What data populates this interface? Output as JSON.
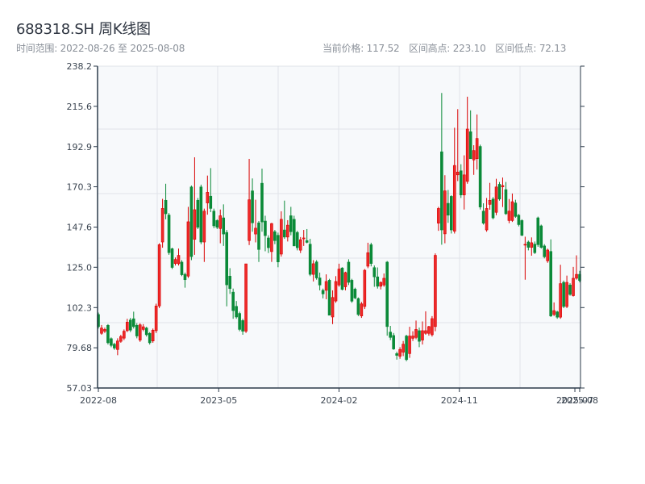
{
  "header": {
    "title": "688318.SH 周K线图",
    "range_label": "时间范围: 2022-08-26 至 2025-08-08",
    "stats": [
      "当前价格: 117.52",
      "区间高点: 223.10",
      "区间低点: 72.13"
    ]
  },
  "colors": {
    "up": "#d90000",
    "down": "#0b8a38",
    "axis": "#2b3a4a",
    "grid": "#e1e4e9",
    "plot_bg": "#f7f9fb"
  },
  "chart_data": {
    "type": "candlestick",
    "title": "688318.SH 周K线图",
    "ylim": [
      57.03,
      238.2
    ],
    "yticks": [
      "57.03",
      "79.68",
      "102.3",
      "125.0",
      "147.6",
      "170.3",
      "192.9",
      "215.6",
      "238.2"
    ],
    "xticks": [
      {
        "label": "2022-08",
        "at": 0
      },
      {
        "label": "2023-05",
        "at": 37.5
      },
      {
        "label": "2024-02",
        "at": 75
      },
      {
        "label": "2024-11",
        "at": 112.5
      },
      {
        "label": "2025-07",
        "at": 148.5
      },
      {
        "label": "2025-08",
        "at": 150
      }
    ],
    "grid": true,
    "ohlc_fields": [
      "open",
      "high",
      "low",
      "close"
    ],
    "candles": [
      [
        98.4,
        99.5,
        90.5,
        91.6
      ],
      [
        87.8,
        92.5,
        87,
        90.8
      ],
      [
        89,
        91,
        88,
        90
      ],
      [
        92.3,
        93,
        81.5,
        82.5
      ],
      [
        84.8,
        85.5,
        80,
        81
      ],
      [
        81.7,
        82.5,
        78.5,
        79.5
      ],
      [
        78.7,
        85,
        75.5,
        83.5
      ],
      [
        83.3,
        87,
        82.5,
        86
      ],
      [
        85.1,
        90,
        84,
        89
      ],
      [
        89.3,
        96,
        88.5,
        94.1
      ],
      [
        95.3,
        96.5,
        88.5,
        89.6
      ],
      [
        96,
        100,
        90.5,
        91.6
      ],
      [
        92.3,
        93.5,
        85,
        86.3
      ],
      [
        84,
        93.5,
        83,
        92.6
      ],
      [
        90,
        93,
        89,
        91.5
      ],
      [
        90.8,
        91.5,
        86,
        87
      ],
      [
        87.8,
        88.5,
        81.5,
        82.5
      ],
      [
        83.5,
        90.5,
        82.5,
        89.6
      ],
      [
        89.3,
        104.5,
        88,
        103.2
      ],
      [
        103.2,
        138.5,
        102,
        137.7
      ],
      [
        139.2,
        163.5,
        136,
        158.1
      ],
      [
        162.7,
        172,
        152,
        155.1
      ],
      [
        154.4,
        155.5,
        132,
        133.2
      ],
      [
        135.4,
        136,
        124,
        124.9
      ],
      [
        127.1,
        130.5,
        126,
        129.4
      ],
      [
        127,
        135.5,
        126,
        131.7
      ],
      [
        127.9,
        129,
        120,
        120.8
      ],
      [
        121,
        122,
        113.5,
        118
      ],
      [
        120,
        159,
        119,
        150.6
      ],
      [
        170.2,
        171,
        129,
        131
      ],
      [
        140.7,
        186.9,
        132,
        157.4
      ],
      [
        162.7,
        164,
        146.5,
        147.5
      ],
      [
        170.2,
        171.5,
        138,
        139.2
      ],
      [
        139.2,
        158,
        128,
        156.6
      ],
      [
        161.2,
        176.6,
        154.6,
        167.2
      ],
      [
        165,
        180.8,
        156,
        158.1
      ],
      [
        156.6,
        158,
        147,
        148.3
      ],
      [
        151.3,
        152,
        146.5,
        147.5
      ],
      [
        146.8,
        157.5,
        138.5,
        154
      ],
      [
        152.8,
        160.4,
        137,
        143.7
      ],
      [
        144.6,
        146,
        103,
        115.1
      ],
      [
        120,
        124.5,
        110,
        113
      ],
      [
        111,
        113,
        96,
        100.6
      ],
      [
        103,
        106,
        96,
        97
      ],
      [
        99,
        100,
        89,
        90
      ],
      [
        95,
        96,
        87,
        89
      ],
      [
        89,
        127,
        88,
        126.9
      ],
      [
        140,
        186,
        137.5,
        163
      ],
      [
        168,
        175,
        145,
        150
      ],
      [
        143.7,
        163,
        139,
        147
      ],
      [
        150,
        151,
        128,
        135
      ],
      [
        172.3,
        180.5,
        145,
        150.5
      ],
      [
        151,
        154,
        134,
        142.8
      ],
      [
        141.5,
        143,
        133,
        136
      ],
      [
        133.8,
        150,
        128,
        149.6
      ],
      [
        145,
        146,
        138,
        140
      ],
      [
        143,
        144.5,
        125,
        128
      ],
      [
        132.4,
        156.5,
        131,
        152
      ],
      [
        146,
        162.5,
        141,
        142
      ],
      [
        142,
        151.5,
        139.5,
        148.7
      ],
      [
        154,
        159,
        143,
        145
      ],
      [
        152,
        154,
        137,
        137
      ],
      [
        144.6,
        145.5,
        134.5,
        136
      ],
      [
        134.6,
        142,
        133,
        140.5
      ],
      [
        141,
        146,
        137,
        141.5
      ],
      [
        140,
        146.5,
        138.5,
        139
      ],
      [
        138,
        141,
        120,
        121
      ],
      [
        121,
        129,
        117,
        127
      ],
      [
        128,
        129,
        118,
        119
      ],
      [
        119,
        122,
        112,
        115
      ],
      [
        112,
        113,
        107.5,
        110
      ],
      [
        112,
        121,
        107,
        117
      ],
      [
        117.7,
        118.5,
        98,
        98
      ],
      [
        97,
        112,
        93,
        108
      ],
      [
        106,
        120,
        105,
        117
      ],
      [
        115,
        127,
        114,
        124
      ],
      [
        124.6,
        125,
        112,
        112.5
      ],
      [
        114,
        122.5,
        112,
        122
      ],
      [
        127.9,
        129.5,
        115,
        116.5
      ],
      [
        117.7,
        118.5,
        105,
        105.9
      ],
      [
        112.7,
        113.5,
        107,
        107.7
      ],
      [
        107.4,
        108,
        97.5,
        98.4
      ],
      [
        97.6,
        105.5,
        96.5,
        104.4
      ],
      [
        102.9,
        124,
        101.5,
        123.3
      ],
      [
        125.6,
        138.8,
        124.5,
        133.2
      ],
      [
        137.7,
        138.8,
        125.5,
        127.1
      ],
      [
        124.8,
        126,
        114,
        119.6
      ],
      [
        119.6,
        124.9,
        113,
        114.3
      ],
      [
        114.3,
        117,
        112.5,
        116.5
      ],
      [
        115,
        121.5,
        114,
        118.8
      ],
      [
        127.9,
        128.5,
        86.5,
        91.6
      ],
      [
        88.5,
        92,
        84,
        85.5
      ],
      [
        86.6,
        88,
        78.5,
        79
      ],
      [
        76.4,
        77.5,
        73,
        75.4
      ],
      [
        74.9,
        80,
        73.5,
        78.7
      ],
      [
        77.2,
        83.5,
        75,
        81.7
      ],
      [
        86.3,
        87,
        72.13,
        73
      ],
      [
        76.4,
        91.5,
        74,
        86.3
      ],
      [
        85,
        89,
        83.5,
        86.3
      ],
      [
        85.5,
        95,
        84.5,
        90
      ],
      [
        89.3,
        91,
        80,
        83.3
      ],
      [
        84,
        94.5,
        81.5,
        89.3
      ],
      [
        87.8,
        100.2,
        87,
        89.3
      ],
      [
        87.8,
        92,
        86.5,
        91.6
      ],
      [
        87,
        97.5,
        86,
        96.1
      ],
      [
        91.6,
        132.8,
        89,
        131.7
      ],
      [
        149.8,
        159,
        145.5,
        158.1
      ],
      [
        190,
        223.1,
        137.7,
        146
      ],
      [
        143.8,
        176.8,
        138.5,
        168
      ],
      [
        161,
        168.5,
        150,
        154.3
      ],
      [
        164.9,
        165.5,
        144,
        146
      ],
      [
        145.3,
        203.5,
        144,
        182.3
      ],
      [
        177,
        214,
        173.5,
        178.6
      ],
      [
        179.3,
        183,
        164,
        165.7
      ],
      [
        165.7,
        188,
        157.5,
        177
      ],
      [
        173.3,
        221,
        172,
        202.8
      ],
      [
        201.3,
        213.3,
        186,
        186.1
      ],
      [
        185.4,
        193.7,
        177,
        190.7
      ],
      [
        186.1,
        211,
        180,
        197.5
      ],
      [
        193,
        194,
        157.5,
        158.9
      ],
      [
        156.6,
        161,
        149,
        149.8
      ],
      [
        146,
        164,
        145,
        158.1
      ],
      [
        160.4,
        172.5,
        157.4,
        162.7
      ],
      [
        163.4,
        164.5,
        152,
        152.8
      ],
      [
        155.9,
        174.8,
        154.3,
        170.2
      ],
      [
        171.7,
        173,
        162.5,
        163.4
      ],
      [
        170.3,
        175.5,
        158.9,
        171
      ],
      [
        168.7,
        173,
        154.5,
        155.1
      ],
      [
        151.3,
        163.4,
        149.8,
        156.6
      ],
      [
        151.3,
        166.5,
        150.5,
        161.9
      ],
      [
        161.2,
        163,
        152.8,
        153.6
      ],
      [
        154.3,
        155,
        148,
        149
      ],
      [
        151.3,
        152,
        142.5,
        143
      ],
      [
        137.7,
        142.2,
        118,
        137.9
      ],
      [
        139.2,
        140,
        134.5,
        136.2
      ],
      [
        136.2,
        141.8,
        131.5,
        138.8
      ],
      [
        138,
        139.5,
        132.5,
        133.2
      ],
      [
        152.8,
        153.5,
        136.5,
        137.7
      ],
      [
        148.3,
        149,
        135.5,
        136.2
      ],
      [
        137,
        138,
        130,
        130.9
      ],
      [
        128.6,
        135.5,
        127.5,
        134.7
      ],
      [
        133.9,
        140.7,
        97,
        97.6
      ],
      [
        98.4,
        105.2,
        97.5,
        100.6
      ],
      [
        99.9,
        100.5,
        96,
        96.9
      ],
      [
        96.9,
        126.4,
        96,
        115.8
      ],
      [
        116.5,
        117.5,
        102,
        102.9
      ],
      [
        102.9,
        120.3,
        102,
        116.5
      ],
      [
        115,
        116,
        109,
        109.7
      ],
      [
        109,
        125.2,
        108.5,
        118.8
      ],
      [
        118.8,
        131.7,
        118,
        121
      ],
      [
        121,
        123,
        116.5,
        117.52
      ]
    ]
  }
}
